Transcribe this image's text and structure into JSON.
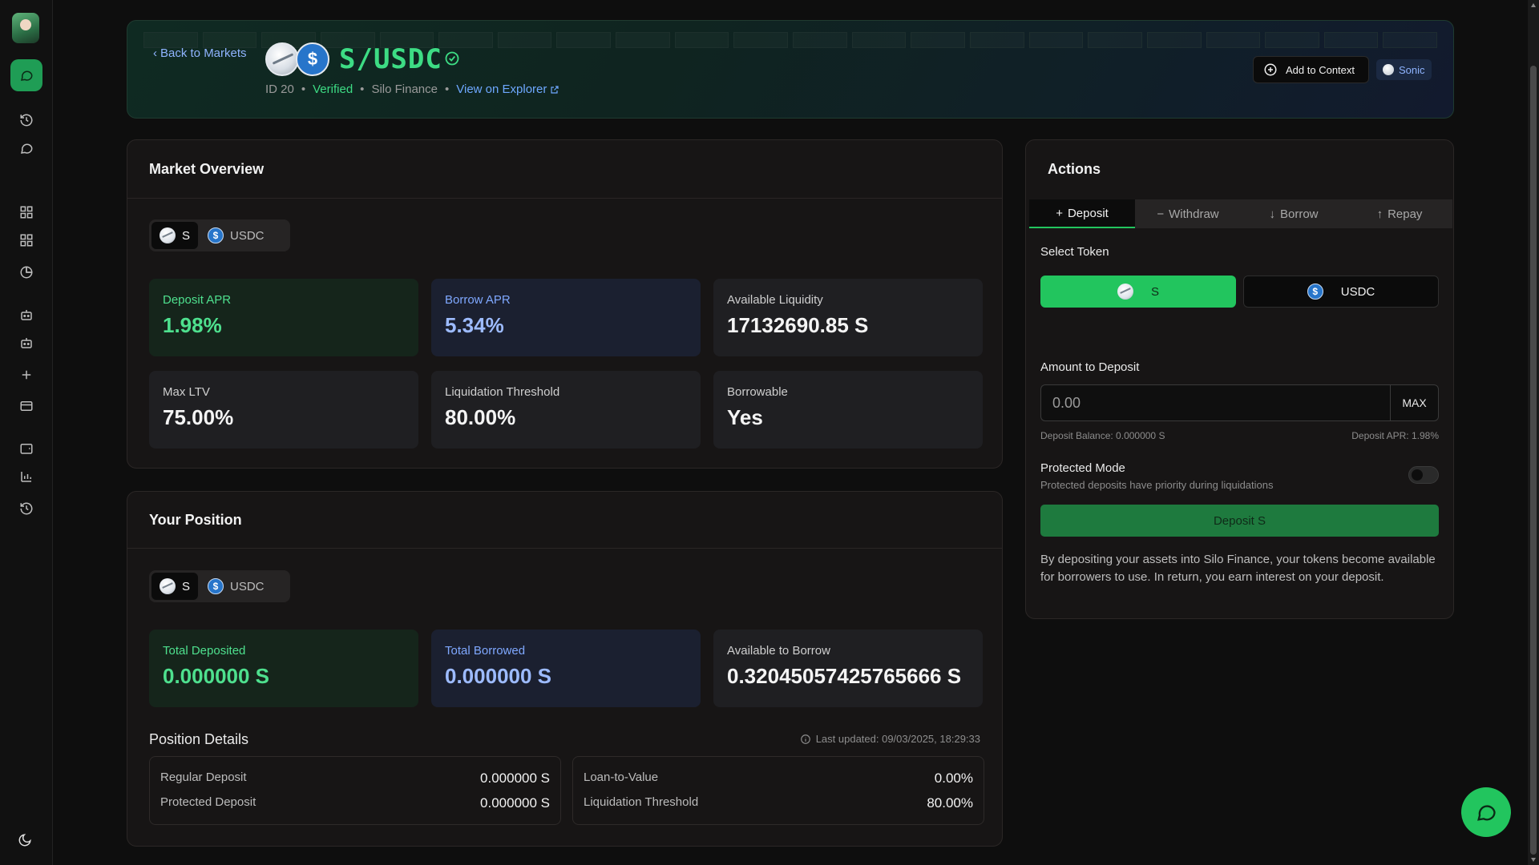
{
  "header": {
    "back_label": "Back to Markets",
    "pair": "S/USDC",
    "id_label": "ID 20",
    "verified_label": "Verified",
    "protocol": "Silo Finance",
    "explorer_label": "View on Explorer",
    "add_context_label": "Add to Context",
    "network": "Sonic"
  },
  "overview": {
    "title": "Market Overview",
    "tokens": [
      "S",
      "USDC"
    ],
    "stats": [
      {
        "label": "Deposit APR",
        "value": "1.98%"
      },
      {
        "label": "Borrow APR",
        "value": "5.34%"
      },
      {
        "label": "Available Liquidity",
        "value": "17132690.85 S"
      },
      {
        "label": "Max LTV",
        "value": "75.00%"
      },
      {
        "label": "Liquidation Threshold",
        "value": "80.00%"
      },
      {
        "label": "Borrowable",
        "value": "Yes"
      }
    ]
  },
  "position": {
    "title": "Your Position",
    "tokens": [
      "S",
      "USDC"
    ],
    "stats": [
      {
        "label": "Total Deposited",
        "value": "0.000000 S"
      },
      {
        "label": "Total Borrowed",
        "value": "0.000000 S"
      },
      {
        "label": "Available to Borrow",
        "value": "0.32045057425765666 S"
      }
    ],
    "details_title": "Position Details",
    "last_updated": "Last updated: 09/03/2025, 18:29:33",
    "left_rows": [
      {
        "k": "Regular Deposit",
        "v": "0.000000 S"
      },
      {
        "k": "Protected Deposit",
        "v": "0.000000 S"
      }
    ],
    "right_rows": [
      {
        "k": "Loan-to-Value",
        "v": "0.00%"
      },
      {
        "k": "Liquidation Threshold",
        "v": "80.00%"
      }
    ]
  },
  "actions": {
    "title": "Actions",
    "tabs": [
      "Deposit",
      "Withdraw",
      "Borrow",
      "Repay"
    ],
    "select_token_label": "Select Token",
    "tokens": [
      "S",
      "USDC"
    ],
    "amount_label": "Amount to Deposit",
    "amount_placeholder": "0.00",
    "max_label": "MAX",
    "deposit_balance": "Deposit Balance: 0.000000 S",
    "deposit_apr": "Deposit APR: 1.98%",
    "protected_title": "Protected Mode",
    "protected_sub": "Protected deposits have priority during liquidations",
    "deposit_button": "Deposit S",
    "description": "By depositing your assets into Silo Finance, your tokens become available for borrowers to use. In return, you earn interest on your deposit."
  },
  "colors": {
    "accent_green": "#22c55e",
    "link_blue": "#6ea8ff",
    "background": "#0e0e0e"
  },
  "icons": {
    "sidebar": [
      "avatar",
      "chat-icon",
      "history-icon",
      "message-icon",
      "grid-icon",
      "grid-icon",
      "pie-chart-icon",
      "bot-icon",
      "bot-icon",
      "plus-icon",
      "card-icon",
      "wallet-icon",
      "bar-chart-icon",
      "history-icon",
      "moon-icon"
    ],
    "fab": "chat-icon"
  }
}
